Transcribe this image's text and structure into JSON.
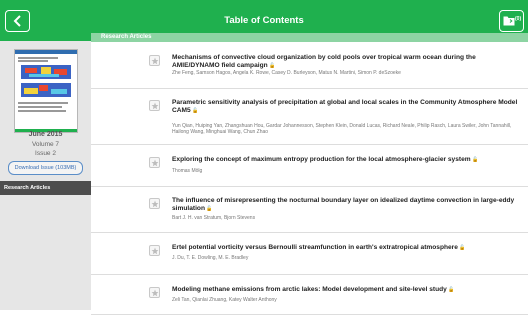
{
  "header": {
    "title": "Table of Contents",
    "folder_count": "(0)"
  },
  "sidebar": {
    "issue_date": "June 2015",
    "volume": "Volume 7",
    "issue": "Issue 2",
    "download_label": "Download Issue (103MB)",
    "nav_item": "Research Articles"
  },
  "section": {
    "title": "Research Articles"
  },
  "articles": [
    {
      "title": "Mechanisms of convective cloud organization by cold pools over tropical warm ocean during the AMIE/DYNAMO field campaign",
      "authors": "Zhe Feng, Samson Hagos, Angela K. Rowe, Casey D. Burleyson, Matus N. Martini, Simon P. deSzoeke"
    },
    {
      "title": "Parametric sensitivity analysis of precipitation at global and local scales in the Community Atmosphere Model CAM5",
      "authors": "Yun Qian, Huiping Yan, Zhangshuan Hou, Gardar Johannesson, Stephen Klein, Donald Lucas, Richard Neale, Philip Rasch, Laura Swiler, John Tannahill, Hailong Wang, Minghuai Wang, Chun Zhao"
    },
    {
      "title": "Exploring the concept of maximum entropy production for the local atmosphere-glacier system",
      "authors": "Thomas Mölg"
    },
    {
      "title": "The influence of misrepresenting the nocturnal boundary layer on idealized daytime convection in large-eddy simulation",
      "authors": "Bart J. H. van Stratum, Bjorn Stevens"
    },
    {
      "title": "Ertel potential vorticity versus Bernoulli streamfunction in earth's extratropical atmosphere",
      "authors": "J. Du, T. E. Dowling, M. E. Bradley"
    },
    {
      "title": "Modeling methane emissions from arctic lakes: Model development and site-level study",
      "authors": "Zeli Tan, Qianlai Zhuang, Katey Walter Anthony"
    }
  ],
  "colors": {
    "brand": "#1fb04e",
    "section_bar": "#8dd4a3",
    "download_text": "#3a6fb5",
    "nav_active": "#4d4d4d"
  },
  "icons": {
    "back": "chevron-left-icon",
    "folder": "folder-icon",
    "star": "star-icon",
    "open_access": "lock-open-icon"
  }
}
